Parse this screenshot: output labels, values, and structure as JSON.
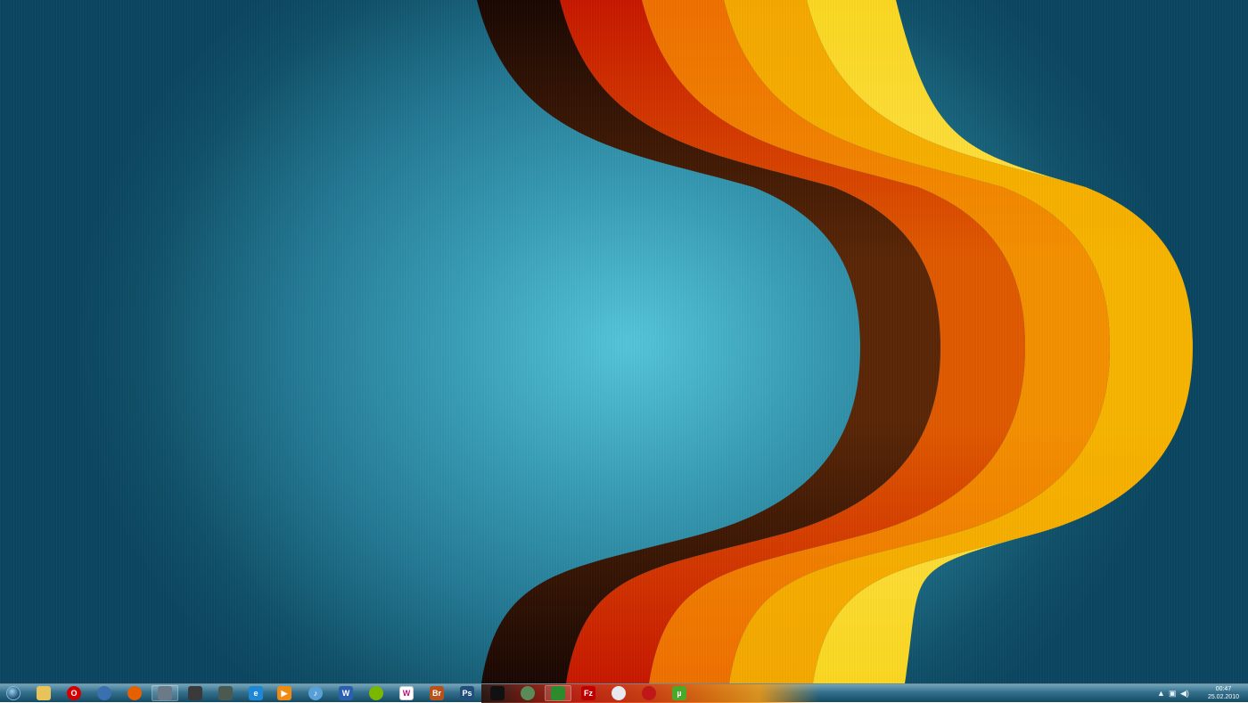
{
  "desktop": {
    "background_colors": {
      "center": "#55c6da",
      "edge": "#0b4660"
    },
    "wave_colors": [
      "#1a0702",
      "#c81800",
      "#f07000",
      "#f6a800",
      "#fcd820"
    ]
  },
  "taskbar": {
    "start_button": {
      "icon": "windows-logo-icon"
    },
    "pinned": [
      {
        "id": "explorer",
        "icon": "folder-icon",
        "color": "#e8c35a"
      },
      {
        "id": "opera",
        "icon": "opera-icon",
        "color": "#d40000",
        "label": "O"
      },
      {
        "id": "thunderbird",
        "icon": "mail-bird-icon",
        "color": "#3a6fb0"
      },
      {
        "id": "firefox",
        "icon": "firefox-icon",
        "color": "#e66000"
      },
      {
        "id": "gaming",
        "icon": "controller-icon",
        "color": "#6a7a86"
      },
      {
        "id": "alien",
        "icon": "alien-icon",
        "color": "#3a3a3a"
      },
      {
        "id": "utility",
        "icon": "utility-icon",
        "color": "#4a5a50"
      },
      {
        "id": "ie",
        "icon": "internet-explorer-icon",
        "color": "#1e88d8",
        "label": "e"
      },
      {
        "id": "media",
        "icon": "media-player-icon",
        "color": "#f08a10",
        "label": "▶"
      },
      {
        "id": "itunes",
        "icon": "music-note-icon",
        "color": "#5aa0d8",
        "label": "♪"
      },
      {
        "id": "word",
        "icon": "word-icon",
        "color": "#2b5fb0",
        "label": "W"
      },
      {
        "id": "spotify",
        "icon": "spotify-icon",
        "color": "#7ab800"
      },
      {
        "id": "winamp",
        "icon": "w-logo-icon",
        "color": "#ffffff",
        "label": "W"
      },
      {
        "id": "bridge",
        "icon": "bridge-icon",
        "color": "#b7531a",
        "label": "Br"
      },
      {
        "id": "photoshop",
        "icon": "photoshop-icon",
        "color": "#1f4f7a",
        "label": "Ps"
      },
      {
        "id": "steam",
        "icon": "steam-icon",
        "color": "#111111"
      },
      {
        "id": "recycle",
        "icon": "recycle-icon",
        "color": "#5a8a5a"
      },
      {
        "id": "nvidia",
        "icon": "eye-icon",
        "color": "#2d8a2d"
      },
      {
        "id": "filezilla",
        "icon": "filezilla-icon",
        "color": "#bf0000",
        "label": "Fz"
      },
      {
        "id": "cd",
        "icon": "disc-icon",
        "color": "#e8e8f0"
      },
      {
        "id": "red-app",
        "icon": "red-circle-icon",
        "color": "#c01818"
      },
      {
        "id": "utorrent",
        "icon": "utorrent-icon",
        "color": "#4aa82a",
        "label": "µ"
      }
    ],
    "tray": {
      "show_hidden_icon": "chevron-up-icon",
      "network_icon": "network-icon",
      "volume_icon": "volume-icon",
      "time": "00:47",
      "date": "25.02.2010"
    }
  }
}
